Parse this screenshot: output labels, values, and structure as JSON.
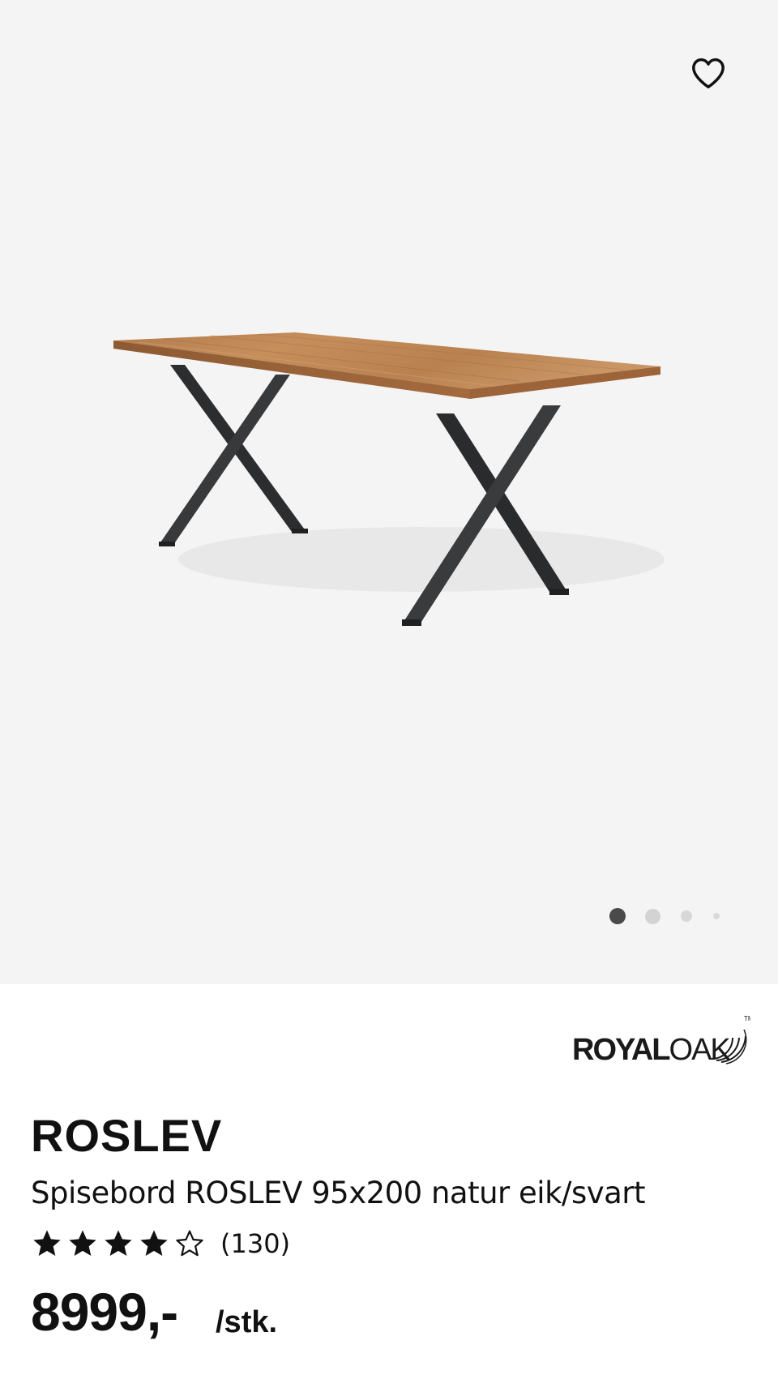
{
  "brand": {
    "logo_text_bold": "ROYAL",
    "logo_text_light": "OAK",
    "trademark": "TM"
  },
  "gallery": {
    "total_images": 4,
    "current_index": 1,
    "image_icon": "dining-table-photo",
    "favorite_icon": "heart-outline-icon"
  },
  "product": {
    "name": "ROSLEV",
    "description": "Spisebord ROSLEV 95x200 natur eik/svart",
    "rating": 4,
    "rating_max": 5,
    "review_count": "(130)",
    "price": "8999,-",
    "unit": "/stk."
  },
  "colors": {
    "gallery_bg": "#f5f4f5",
    "dot_active": "#4a4a4a",
    "dot_inactive": "#d3d3d3",
    "text": "#111111"
  }
}
